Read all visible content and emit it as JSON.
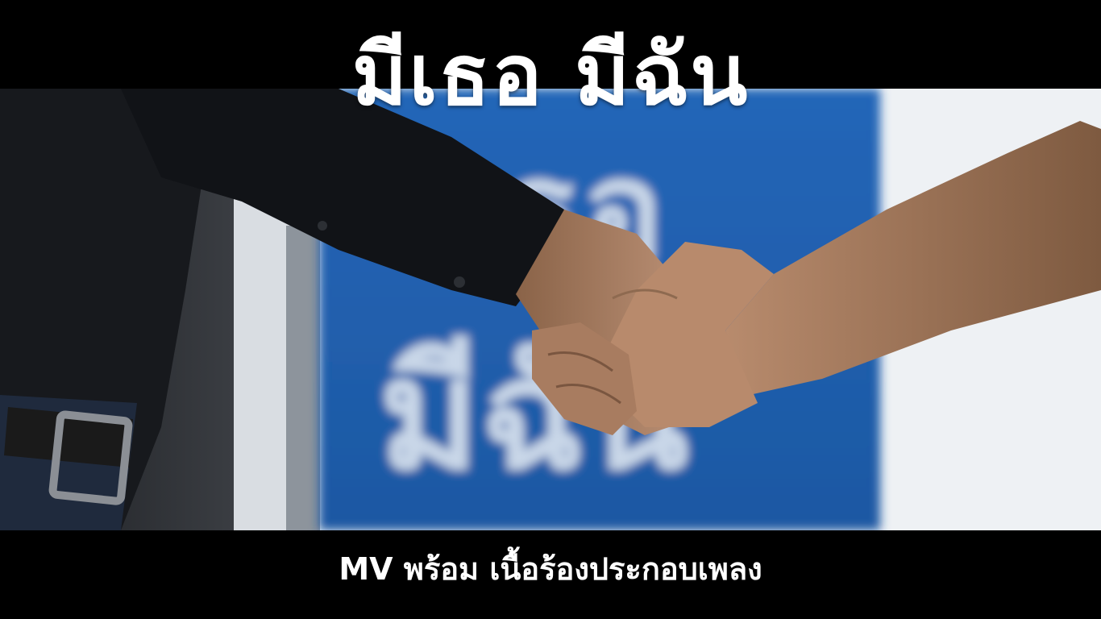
{
  "video": {
    "title": "มีเธอ มีฉัน",
    "caption": "MV พร้อม เนื้อร้องประกอบเพลง"
  },
  "scene": {
    "sign_text_top": "เธอ",
    "sign_text_bottom": "มีฉัน",
    "colors": {
      "letterbox": "#000000",
      "sign_blue": "#1f5fb0",
      "window_light": "#f2f4f6",
      "shirt_dark": "#15171b",
      "skin": "#b08466"
    }
  }
}
